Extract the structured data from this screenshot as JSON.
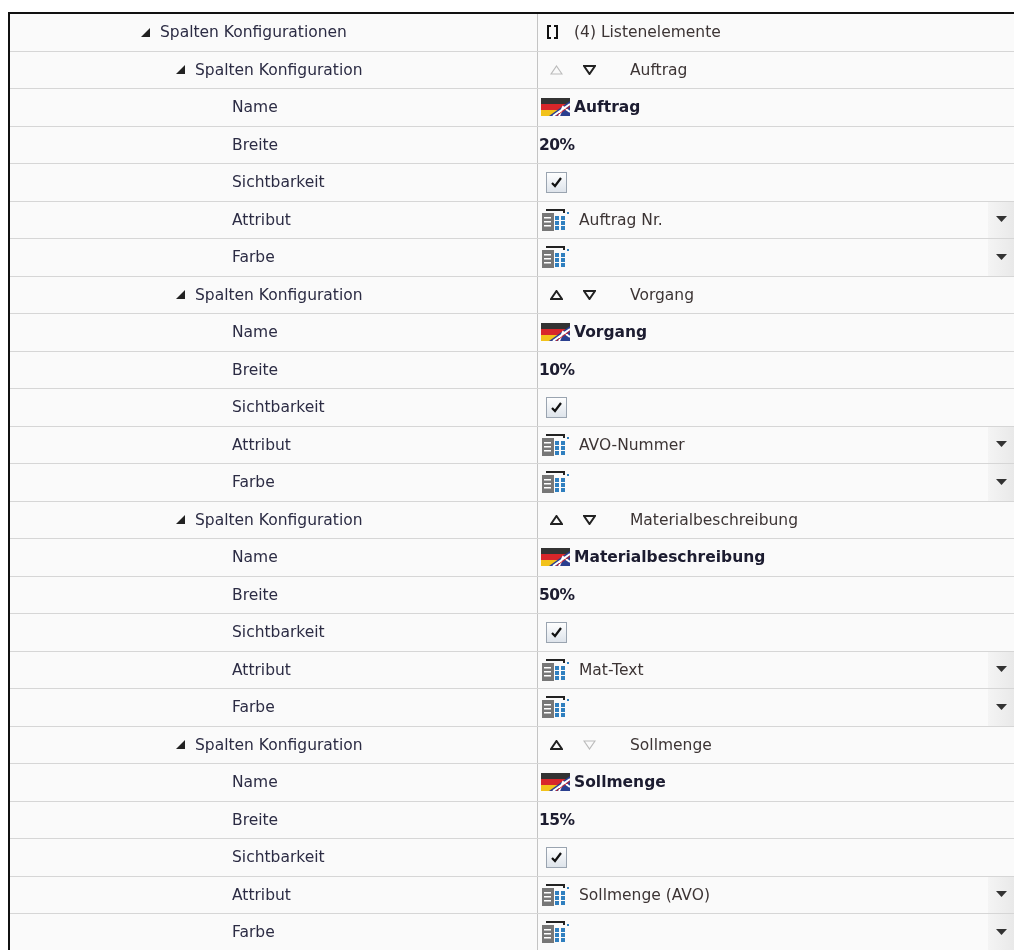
{
  "tree": {
    "label": "Spalten Konfigurationen",
    "expanded": true,
    "value": "(4) Listenelemente",
    "children": [
      {
        "label": "Spalten Konfiguration",
        "expanded": true,
        "title": "Auftrag",
        "can_move_up": false,
        "can_move_down": true,
        "properties": [
          {
            "kind": "name",
            "label": "Name",
            "value": "Auftrag"
          },
          {
            "kind": "text",
            "label": "Breite",
            "value": "20%"
          },
          {
            "kind": "checkbox",
            "label": "Sichtbarkeit",
            "checked": true
          },
          {
            "kind": "dropdown",
            "label": "Attribut",
            "value": "Auftrag Nr."
          },
          {
            "kind": "dropdown",
            "label": "Farbe"
          }
        ]
      },
      {
        "label": "Spalten Konfiguration",
        "expanded": true,
        "title": "Vorgang",
        "can_move_up": true,
        "can_move_down": true,
        "properties": [
          {
            "kind": "name",
            "label": "Name",
            "value": "Vorgang"
          },
          {
            "kind": "text",
            "label": "Breite",
            "value": "10%"
          },
          {
            "kind": "checkbox",
            "label": "Sichtbarkeit",
            "checked": true
          },
          {
            "kind": "dropdown",
            "label": "Attribut",
            "value": "AVO-Nummer"
          },
          {
            "kind": "dropdown",
            "label": "Farbe"
          }
        ]
      },
      {
        "label": "Spalten Konfiguration",
        "expanded": true,
        "title": "Materialbeschreibung",
        "can_move_up": true,
        "can_move_down": true,
        "properties": [
          {
            "kind": "name",
            "label": "Name",
            "value": "Materialbeschreibung"
          },
          {
            "kind": "text",
            "label": "Breite",
            "value": "50%"
          },
          {
            "kind": "checkbox",
            "label": "Sichtbarkeit",
            "checked": true
          },
          {
            "kind": "dropdown",
            "label": "Attribut",
            "value": "Mat-Text"
          },
          {
            "kind": "dropdown",
            "label": "Farbe"
          }
        ]
      },
      {
        "label": "Spalten Konfiguration",
        "expanded": true,
        "title": "Sollmenge",
        "can_move_up": true,
        "can_move_down": false,
        "properties": [
          {
            "kind": "name",
            "label": "Name",
            "value": "Sollmenge"
          },
          {
            "kind": "text",
            "label": "Breite",
            "value": "15%"
          },
          {
            "kind": "checkbox",
            "label": "Sichtbarkeit",
            "checked": true
          },
          {
            "kind": "dropdown",
            "label": "Attribut",
            "value": "Sollmenge (AVO)"
          },
          {
            "kind": "dropdown",
            "label": "Farbe"
          }
        ]
      }
    ]
  }
}
